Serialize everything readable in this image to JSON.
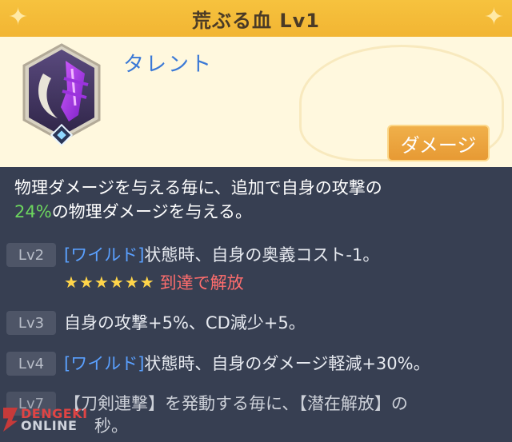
{
  "header": {
    "title": "荒ぶる血 Lv1"
  },
  "skill": {
    "type_label": "タレント",
    "category_tag": "ダメージ",
    "icon_name": "claw-slash-icon"
  },
  "description": {
    "line1": "物理ダメージを与える毎に、追加で自身の攻撃の",
    "percent": "24%",
    "line2_rest": "の物理ダメージを与える。"
  },
  "levels": [
    {
      "badge": "Lv2",
      "keyword": "[ワイルド]",
      "text": "状態時、自身の奥義コスト-1。",
      "stars": 6,
      "unlock_text": "到達で解放"
    },
    {
      "badge": "Lv3",
      "keyword": "",
      "text": "自身の攻撃+5%、CD減少+5。"
    },
    {
      "badge": "Lv4",
      "keyword": "[ワイルド]",
      "text": "状態時、自身のダメージ軽減+30%。"
    },
    {
      "badge": "Lv7",
      "keyword": "",
      "text": "【刀剣連撃】を発動する毎に、【潜在解放】の",
      "text2": "秒。"
    }
  ],
  "watermark": {
    "line1": "DENGEKI",
    "line2": "ONLINE"
  },
  "colors": {
    "title_bar": "#f6c23e",
    "top_panel": "#fff8de",
    "bottom_panel": "#373f52",
    "keyword": "#5aa0ff",
    "percent": "#6cd65e",
    "unlock": "#ff6d6d",
    "tag": "#e79a34"
  }
}
